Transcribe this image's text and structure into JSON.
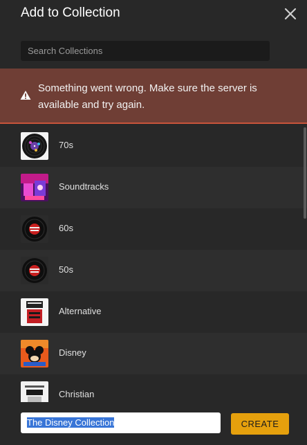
{
  "dialog": {
    "title": "Add to Collection",
    "close_icon": "close-icon"
  },
  "search": {
    "placeholder": "Search Collections",
    "value": ""
  },
  "error": {
    "icon": "warning-icon",
    "message": "Something went wrong. Make sure the server is available and try again."
  },
  "collections": [
    {
      "label": "70s",
      "icon": "vinyl-record-thumb"
    },
    {
      "label": "Soundtracks",
      "icon": "neon-poster-thumb"
    },
    {
      "label": "60s",
      "icon": "vinyl-record-thumb"
    },
    {
      "label": "50s",
      "icon": "vinyl-record-thumb"
    },
    {
      "label": "Alternative",
      "icon": "alternative-art-thumb"
    },
    {
      "label": "Disney",
      "icon": "disney-art-thumb"
    },
    {
      "label": "Christian",
      "icon": "rock-art-thumb"
    }
  ],
  "new_collection": {
    "value": "The Disney Collection",
    "create_label": "CREATE"
  },
  "colors": {
    "accent": "#e5a00d",
    "error_bg": "#6f3e35",
    "error_border": "#c9553b",
    "selection": "#3875d7"
  }
}
